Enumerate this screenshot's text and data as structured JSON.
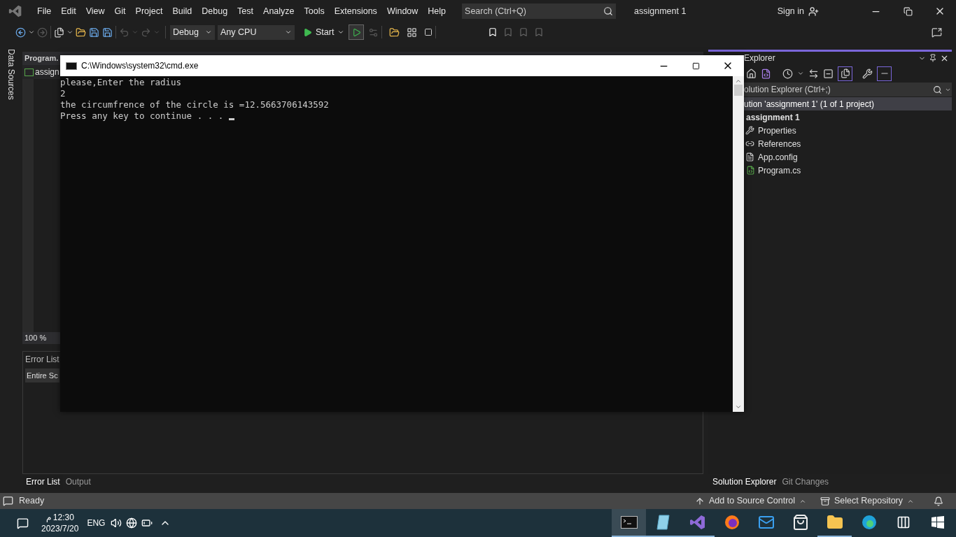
{
  "menu": [
    "File",
    "Edit",
    "View",
    "Git",
    "Project",
    "Build",
    "Debug",
    "Test",
    "Analyze",
    "Tools",
    "Extensions",
    "Window",
    "Help"
  ],
  "search": {
    "placeholder": "Search (Ctrl+Q)"
  },
  "solution_name": "assignment 1",
  "sign_in": "Sign in",
  "toolbar": {
    "configuration": "Debug",
    "platform": "Any CPU",
    "start": "Start"
  },
  "side_tab": "Data Sources",
  "editor": {
    "tab": "Program.",
    "file_tab": "assign",
    "zoom": "100 %"
  },
  "error_list": {
    "title": "Error List",
    "filter": "Entire Sc"
  },
  "bottom_tabs": [
    {
      "label": "Error List",
      "selected": true
    },
    {
      "label": "Output",
      "selected": false
    }
  ],
  "console": {
    "title": "C:\\Windows\\system32\\cmd.exe",
    "lines": [
      "please,Enter the radius",
      "2",
      "the circumfrence of the circle is =12.5663706143592",
      "Press any key to continue . . . "
    ]
  },
  "solution_explorer": {
    "title": "Explorer",
    "search_placeholder": "olution Explorer (Ctrl+;)",
    "tree": [
      {
        "label": "ution 'assignment 1' (1 of 1 project)",
        "selected": true,
        "children": [
          {
            "label": "assignment 1",
            "kind": "project",
            "selected": false,
            "children": [
              {
                "label": "Properties",
                "kind": "properties",
                "selected": false
              },
              {
                "label": "References",
                "kind": "references",
                "selected": false
              },
              {
                "label": "App.config",
                "kind": "config",
                "selected": false
              },
              {
                "label": "Program.cs",
                "kind": "csharp",
                "selected": false
              }
            ]
          }
        ]
      }
    ]
  },
  "panel_tabs": [
    {
      "label": "Solution Explorer",
      "selected": true
    },
    {
      "label": "Git Changes",
      "selected": false
    }
  ],
  "status": {
    "text": "Ready",
    "source_control": "Add to Source Control",
    "repository": "Select Repository"
  },
  "taskbar": {
    "time": "12:30 م",
    "date": "2023/7/20",
    "language": "ENG",
    "apps": [
      {
        "kind": "terminal",
        "active": true,
        "running": true
      },
      {
        "kind": "notepad",
        "active": false,
        "running": true
      },
      {
        "kind": "visualstudio",
        "active": false,
        "running": true
      },
      {
        "kind": "firefox",
        "active": false,
        "running": false
      },
      {
        "kind": "mail",
        "active": false,
        "running": false
      },
      {
        "kind": "store",
        "active": false,
        "running": false
      },
      {
        "kind": "folder",
        "active": false,
        "running": true
      },
      {
        "kind": "edge",
        "active": false,
        "running": false
      },
      {
        "kind": "taskview",
        "active": false,
        "running": false
      },
      {
        "kind": "start",
        "active": false,
        "running": false
      }
    ]
  }
}
